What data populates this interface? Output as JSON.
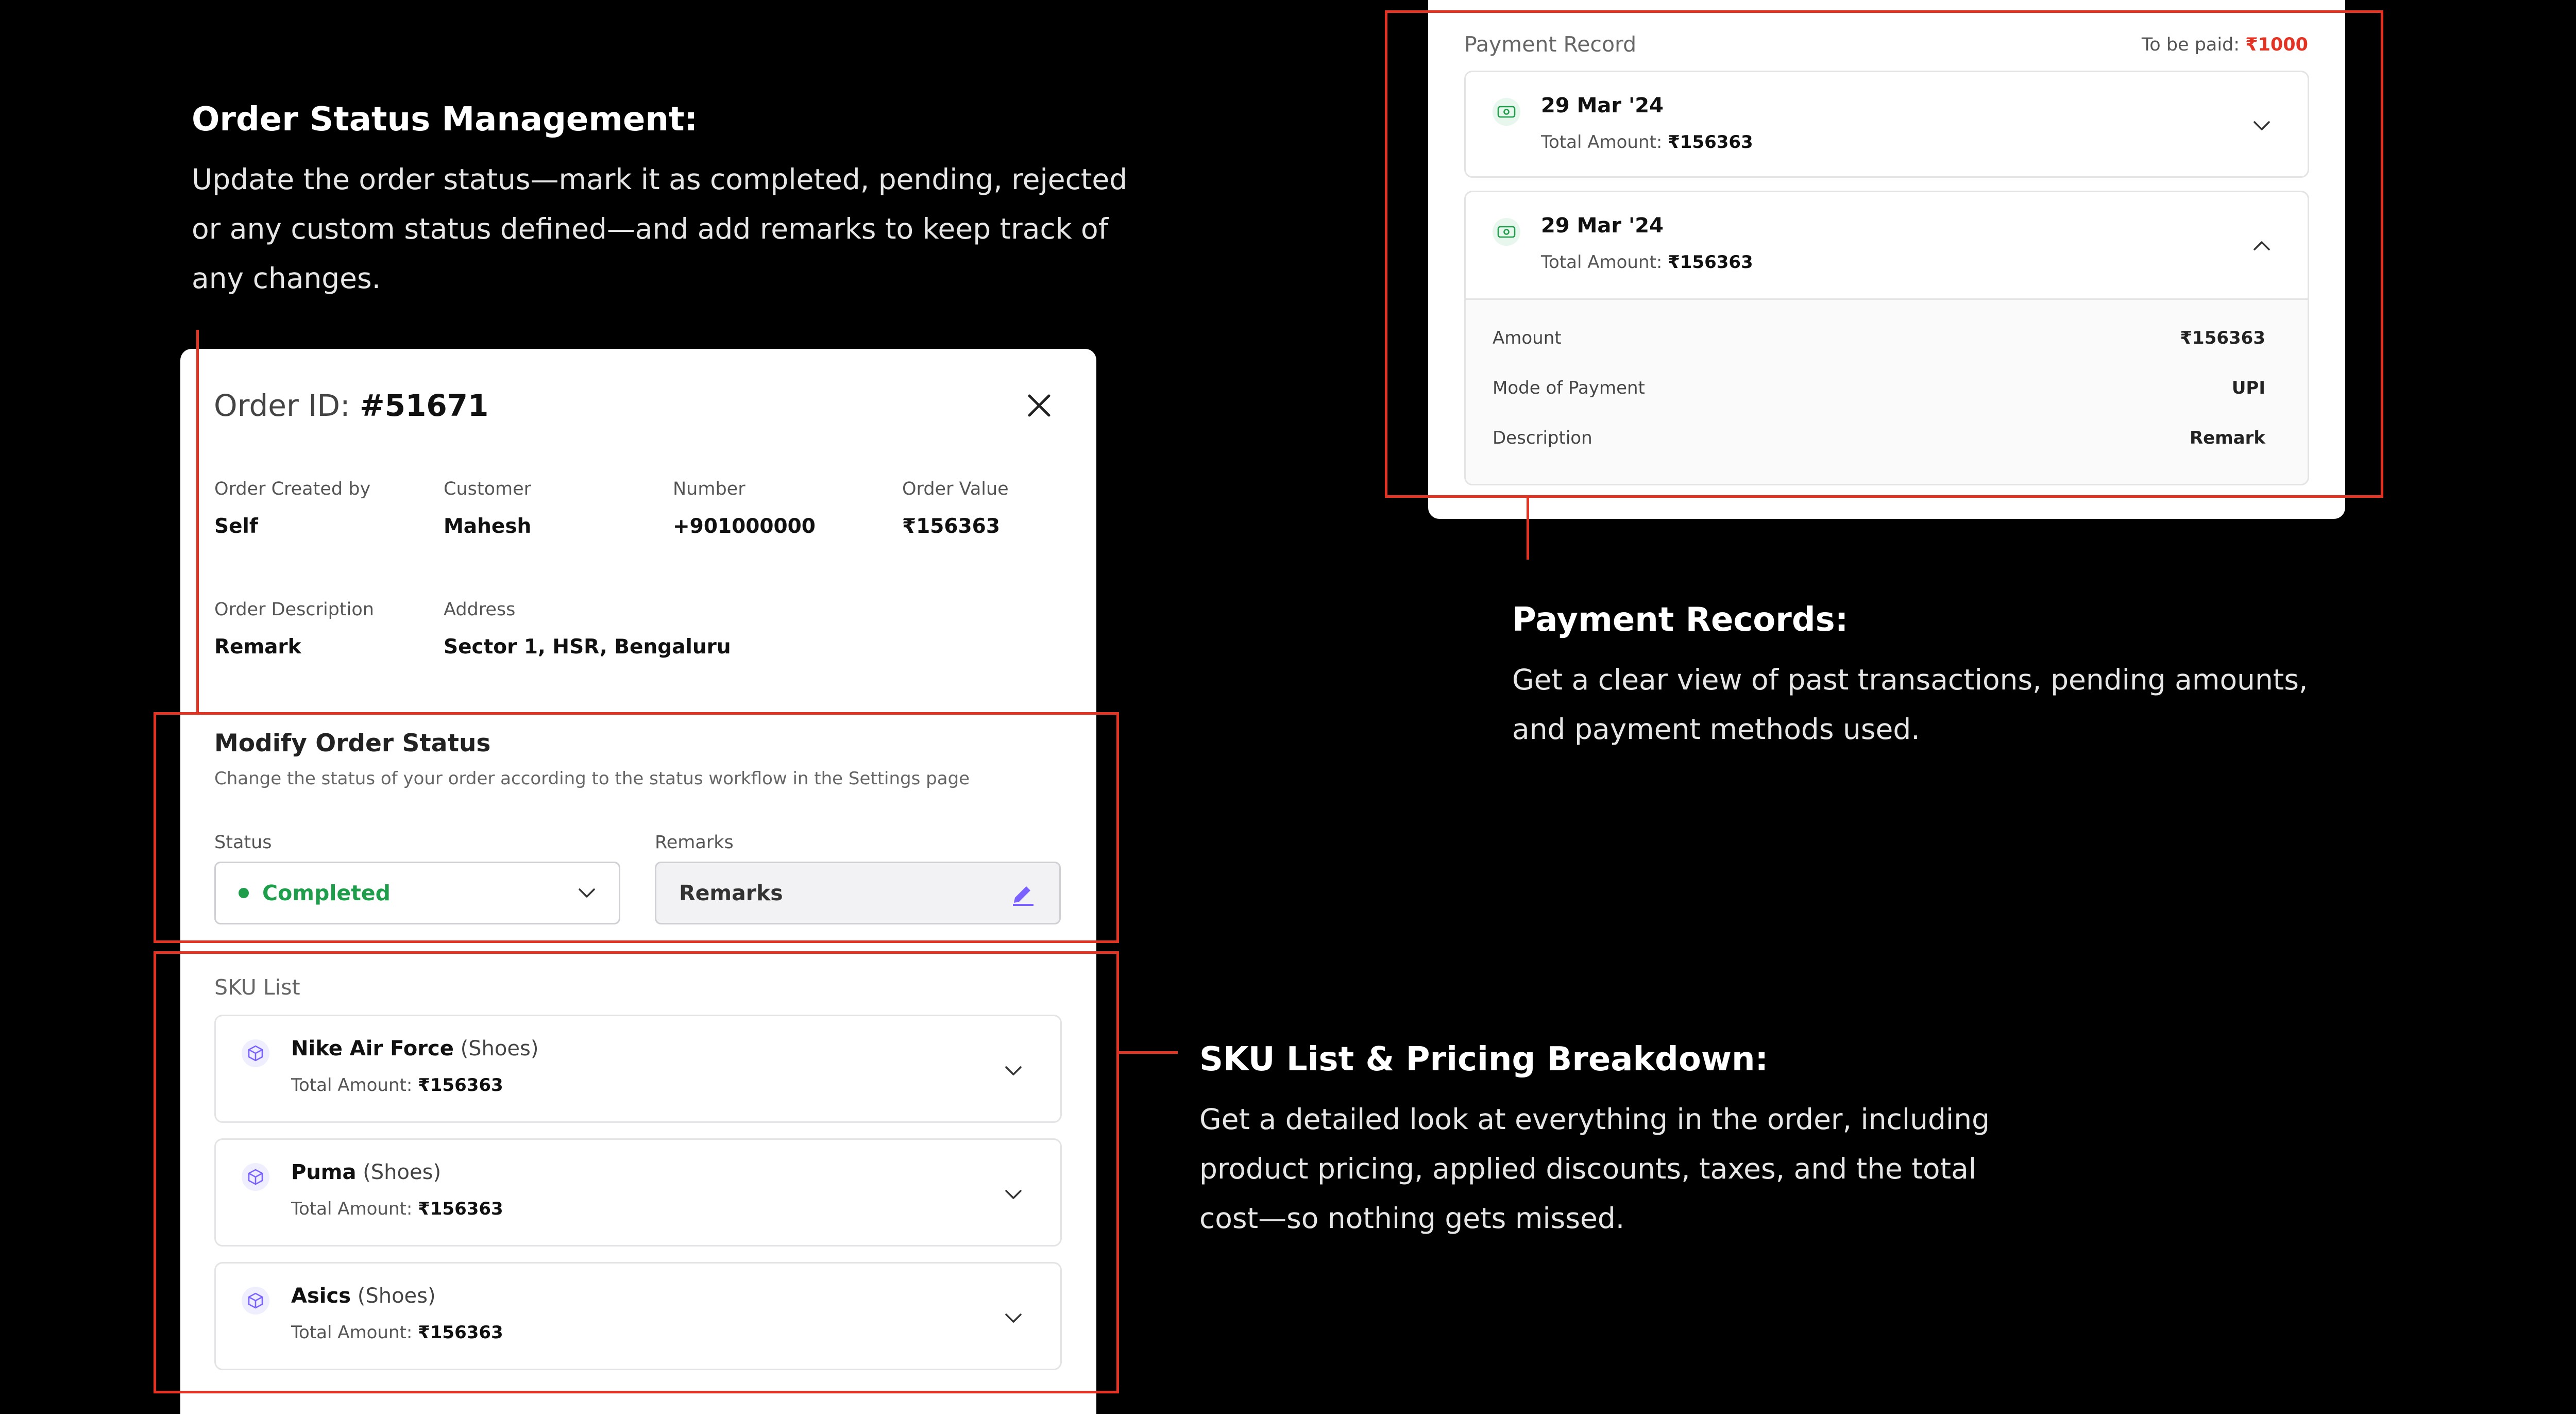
{
  "annotations": {
    "order_status": {
      "title": "Order Status Management:",
      "line1": "Update the order status—mark it as completed, pending, rejected",
      "line2": "or any custom status defined—and add remarks to keep track of",
      "line3": "any changes."
    },
    "payment_records": {
      "title": "Payment Records:",
      "line1": "Get a clear view of past transactions, pending amounts,",
      "line2": "and payment methods used."
    },
    "sku_list": {
      "title": "SKU List & Pricing Breakdown:",
      "line1": "Get a detailed look at everything in the order, including",
      "line2": "product pricing, applied discounts, taxes, and the total",
      "line3": "cost—so nothing gets missed."
    }
  },
  "order": {
    "id_label": "Order ID:",
    "id_value": "#51671",
    "fields": {
      "created_by": {
        "label": "Order Created by",
        "value": "Self"
      },
      "customer": {
        "label": "Customer",
        "value": "Mahesh"
      },
      "number": {
        "label": "Number",
        "value": "+901000000"
      },
      "order_value": {
        "label": "Order Value",
        "value": "₹156363"
      },
      "description": {
        "label": "Order Description",
        "value": "Remark"
      },
      "address": {
        "label": "Address",
        "value": "Sector 1, HSR, Bengaluru"
      }
    },
    "modify": {
      "title": "Modify Order Status",
      "subtitle": "Change the status of your order according to the status workflow in the Settings page",
      "status_label": "Status",
      "status_value": "Completed",
      "remarks_label": "Remarks",
      "remarks_placeholder": "Remarks"
    },
    "sku": {
      "title": "SKU List",
      "total_label": "Total Amount:",
      "items": [
        {
          "name": "Nike Air Force",
          "category": "(Shoes)",
          "amount": "₹156363"
        },
        {
          "name": "Puma",
          "category": "(Shoes)",
          "amount": "₹156363"
        },
        {
          "name": "Asics",
          "category": "(Shoes)",
          "amount": "₹156363"
        }
      ]
    }
  },
  "payment": {
    "title": "Payment Record",
    "to_be_paid_label": "To be paid:",
    "to_be_paid_value": "₹1000",
    "total_label": "Total Amount:",
    "records": [
      {
        "date": "29 Mar '24",
        "amount": "₹156363"
      },
      {
        "date": "29 Mar '24",
        "amount": "₹156363"
      }
    ],
    "details": {
      "amount_label": "Amount",
      "amount_value": "₹156363",
      "mode_label": "Mode of Payment",
      "mode_value": "UPI",
      "desc_label": "Description",
      "desc_value": "Remark"
    }
  },
  "colors": {
    "accent_red": "#e53323",
    "status_green": "#1e9e4a",
    "purple_icon": "#7b61ff"
  }
}
